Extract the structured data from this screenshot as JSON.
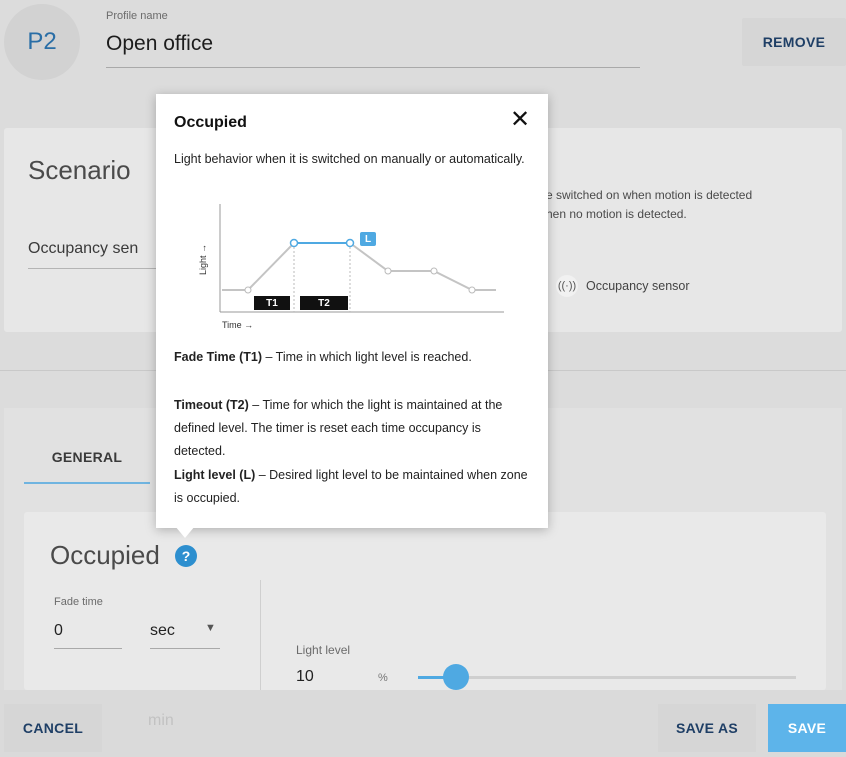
{
  "header": {
    "avatar": "P2",
    "profile_label": "Profile name",
    "profile_value": "Open office",
    "remove_label": "REMOVE"
  },
  "scenario": {
    "title": "Scenario",
    "selected": "Occupancy sen",
    "desc_line1": "e switched on when motion is detected",
    "desc_line2": "hen no motion is detected.",
    "sensor_chip_label": "Occupancy sensor",
    "sensor_icon_glyph": "((·))"
  },
  "tabs": [
    {
      "label": "GENERAL"
    }
  ],
  "occupied": {
    "title": "Occupied",
    "help_glyph": "?",
    "fade_label": "Fade time",
    "fade_value": "0",
    "fade_unit": "sec",
    "light_level_label": "Light level",
    "light_level_value": "10",
    "light_level_unit": "%",
    "light_level_fraction": 0.1
  },
  "popover": {
    "title": "Occupied",
    "close_glyph": "✕",
    "desc": "Light behavior when it is switched on manually or automatically.",
    "chart_tags": {
      "t1": "T1",
      "t2": "T2",
      "l": "L"
    },
    "axis_time": "Time →",
    "axis_light": "Light →",
    "definitions": [
      {
        "term": "Fade Time (T1)",
        "text": " – Time in which light level is reached."
      },
      {
        "term": "Timeout (T2)",
        "text": " – Time for which the light is maintained at the defined level. The timer is reset each time occupancy is detected."
      },
      {
        "term": "Light level (L)",
        "text": " – Desired light level to be maintained when zone is occupied."
      }
    ]
  },
  "footer": {
    "cancel_label": "CANCEL",
    "faded_text": "min",
    "save_as_label": "SAVE AS",
    "save_label": "SAVE"
  },
  "colors": {
    "accent": "#4fa9e2",
    "primary_text": "#1f3f66"
  }
}
